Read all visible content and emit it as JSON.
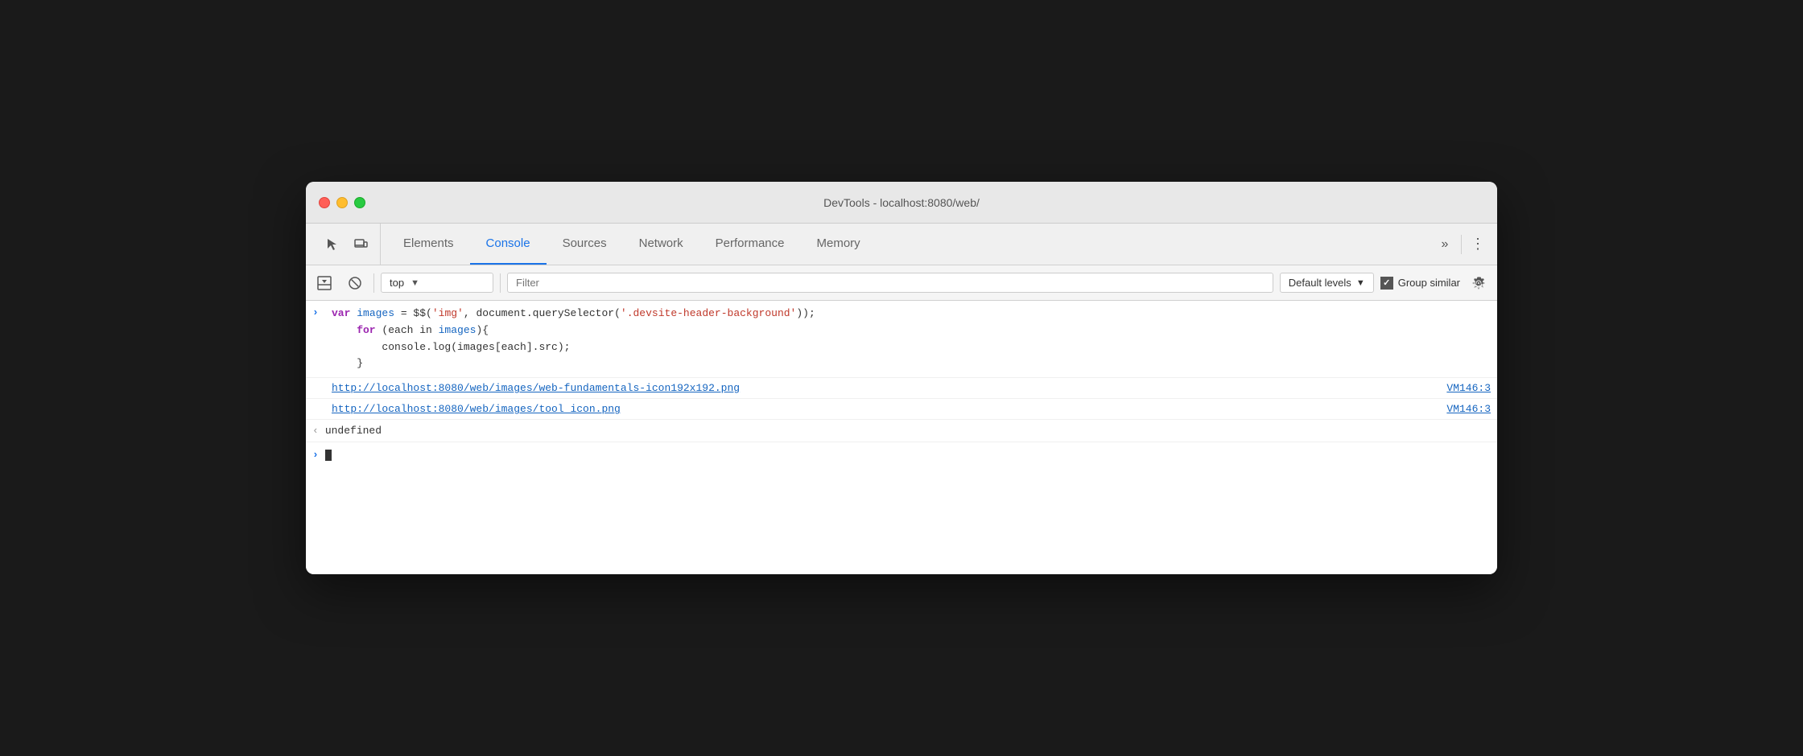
{
  "window": {
    "title": "DevTools - localhost:8080/web/"
  },
  "tabbar": {
    "icons": [
      {
        "name": "cursor-icon",
        "symbol": "↖",
        "label": "Select element"
      },
      {
        "name": "device-icon",
        "symbol": "⬜",
        "label": "Toggle device"
      }
    ],
    "tabs": [
      {
        "id": "elements",
        "label": "Elements",
        "active": false
      },
      {
        "id": "console",
        "label": "Console",
        "active": true
      },
      {
        "id": "sources",
        "label": "Sources",
        "active": false
      },
      {
        "id": "network",
        "label": "Network",
        "active": false
      },
      {
        "id": "performance",
        "label": "Performance",
        "active": false
      },
      {
        "id": "memory",
        "label": "Memory",
        "active": false
      }
    ],
    "more_label": "»",
    "menu_label": "⋮"
  },
  "toolbar": {
    "clear_label": "▶",
    "block_label": "🚫",
    "context_value": "top",
    "context_arrow": "▼",
    "filter_placeholder": "Filter",
    "levels_label": "Default levels",
    "levels_arrow": "▼",
    "group_similar_label": "Group similar",
    "settings_label": "⚙"
  },
  "console": {
    "entries": [
      {
        "type": "input",
        "arrow": ">",
        "code": {
          "line1_parts": [
            {
              "text": "var ",
              "class": "kw-var"
            },
            {
              "text": "images",
              "class": "var-name"
            },
            {
              "text": " = $$(",
              "class": "normal"
            },
            {
              "text": "'img'",
              "class": "str-red"
            },
            {
              "text": ", document.querySelector(",
              "class": "normal"
            },
            {
              "text": "'.devsite-header-background'",
              "class": "str-red"
            },
            {
              "text": "));",
              "class": "normal"
            }
          ],
          "line2_parts": [
            {
              "text": "    for",
              "class": "kw-for"
            },
            {
              "text": " (each in ",
              "class": "normal"
            },
            {
              "text": "images",
              "class": "var-name"
            },
            {
              "text": "){",
              "class": "normal"
            }
          ],
          "line3": "        console.log(images[each].src);",
          "line4": "    }"
        }
      }
    ],
    "links": [
      {
        "url": "http://localhost:8080/web/images/web-fundamentals-icon192x192.png",
        "source": "VM146:3"
      },
      {
        "url": "http://localhost:8080/web/images/tool_icon.png",
        "source": "VM146:3"
      }
    ],
    "undefined_text": "undefined",
    "undefined_arrow": "‹"
  }
}
